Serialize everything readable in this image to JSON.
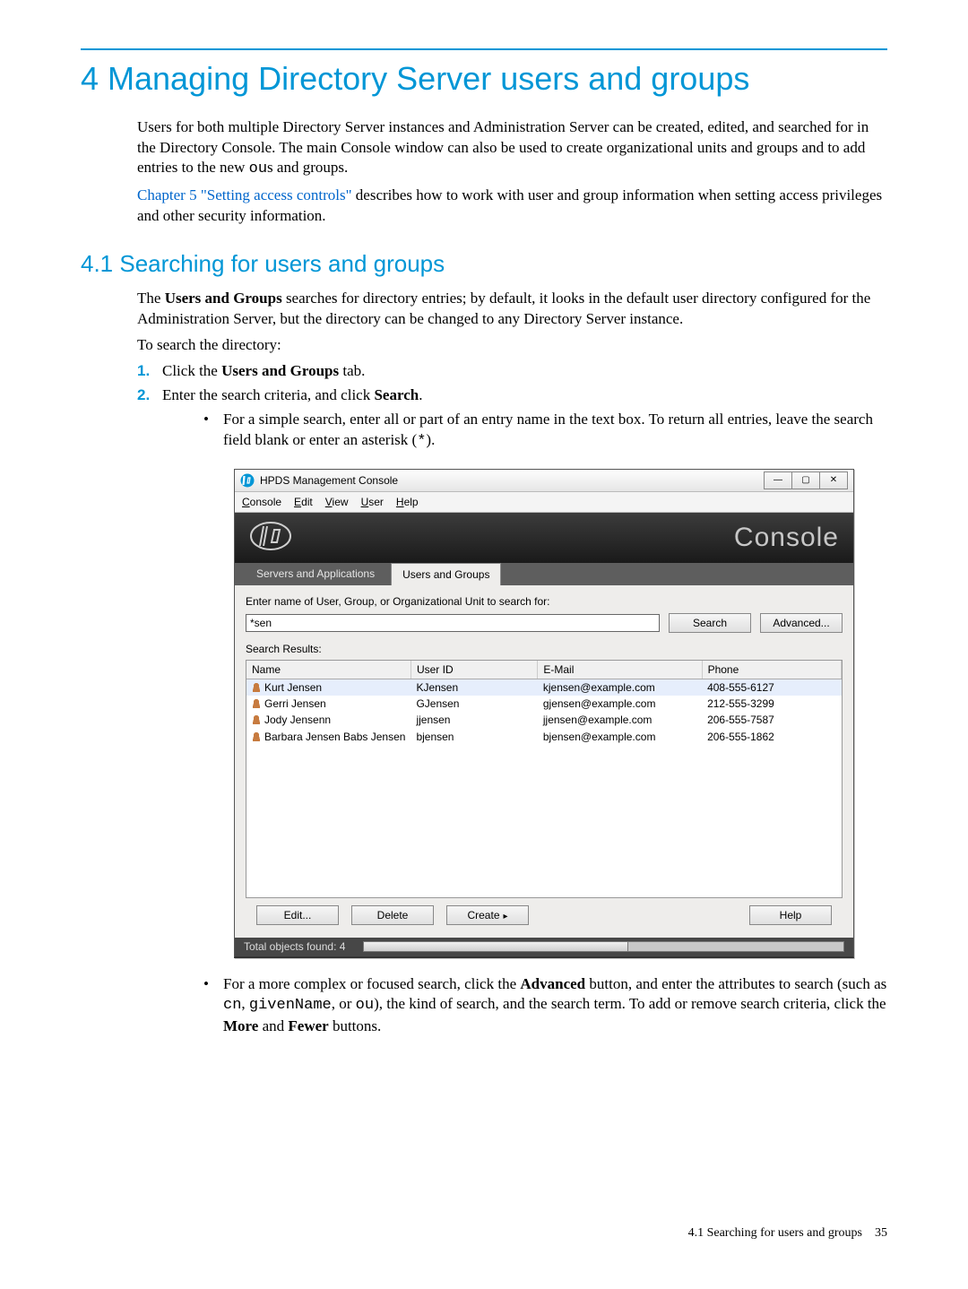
{
  "chapter_title": "4 Managing Directory Server users and groups",
  "intro_p1": "Users for both multiple Directory Server instances and Administration Server can be created, edited, and searched for in the Directory Console. The main Console window can also be used to create organizational units and groups and to add entries to the new ",
  "intro_p1_code": "ou",
  "intro_p1_tail": "s and groups.",
  "intro_p2_link": "Chapter 5 \"Setting access controls\"",
  "intro_p2_tail": " describes how to work with user and group information when setting access privileges and other security information.",
  "section_title": "4.1 Searching for users and groups",
  "sec_p1_a": "The ",
  "sec_p1_b": "Users and Groups",
  "sec_p1_c": " searches for directory entries; by default, it looks in the default user directory configured for the Administration Server, but the directory can be changed to any Directory Server instance.",
  "sec_p2": "To search the directory:",
  "steps": [
    {
      "num": "1.",
      "pre": "Click the ",
      "bold": "Users and Groups",
      "post": " tab."
    },
    {
      "num": "2.",
      "pre": "Enter the search criteria, and click ",
      "bold": "Search",
      "post": "."
    }
  ],
  "bul1_a": "For a simple search, enter all or part of an entry name in the text box. To return all entries, leave the search field blank or enter an asterisk (",
  "bul1_code": "*",
  "bul1_b": ").",
  "bul2_a": "For a more complex or focused search, click the ",
  "bul2_bold1": "Advanced",
  "bul2_b": " button, and enter the attributes to search (such as ",
  "bul2_code1": "cn",
  "bul2_c": ", ",
  "bul2_code2": "givenName",
  "bul2_d": ", or ",
  "bul2_code3": "ou",
  "bul2_e": "), the kind of search, and the search term. To add or remove search criteria, click the ",
  "bul2_bold2": "More",
  "bul2_f": " and ",
  "bul2_bold3": "Fewer",
  "bul2_g": " buttons.",
  "footer_section": "4.1 Searching for users and groups",
  "footer_page": "35",
  "app": {
    "window_title": "HPDS Management Console",
    "menu": [
      "Console",
      "Edit",
      "View",
      "User",
      "Help"
    ],
    "banner_word": "Console",
    "tabs": {
      "inactive": "Servers and Applications",
      "active": "Users and Groups"
    },
    "search_label": "Enter name of User, Group, or Organizational Unit to search for:",
    "search_value": "*sen",
    "search_btn": "Search",
    "advanced_btn": "Advanced...",
    "results_label": "Search Results:",
    "columns": [
      "Name",
      "User ID",
      "E-Mail",
      "Phone"
    ],
    "rows": [
      {
        "name": "Kurt Jensen",
        "uid": "KJensen",
        "mail": "kjensen@example.com",
        "phone": "408-555-6127"
      },
      {
        "name": "Gerri Jensen",
        "uid": "GJensen",
        "mail": "gjensen@example.com",
        "phone": "212-555-3299"
      },
      {
        "name": "Jody Jensenn",
        "uid": "jjensen",
        "mail": "jjensen@example.com",
        "phone": "206-555-7587"
      },
      {
        "name": "Barbara Jensen  Babs Jensen",
        "uid": "bjensen",
        "mail": "bjensen@example.com",
        "phone": "206-555-1862"
      }
    ],
    "buttons": {
      "edit": "Edit...",
      "delete": "Delete",
      "create": "Create",
      "help": "Help"
    },
    "status": "Total objects found: 4"
  }
}
